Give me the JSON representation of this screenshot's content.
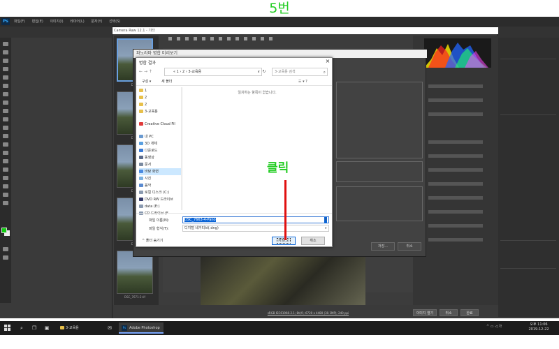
{
  "step_title": "5번",
  "annotation": {
    "label": "클릭"
  },
  "photoshop": {
    "logo": "Ps",
    "menu": [
      "파일(F)",
      "편집(E)",
      "이미지(I)",
      "레이어(L)",
      "문자(Y)",
      "선택(S)"
    ]
  },
  "camera_raw": {
    "title": "Camera Raw 12.1 - 기타",
    "thumbnails": [
      "DSC_",
      "DSC_",
      "DSC_",
      "DSC_",
      "DSC_7671-2.tif"
    ],
    "status_text": "sRGB IEC61966-2.1; 8비트; 6720 x 4480 (30.1MP); 240 ppi",
    "buttons": {
      "open": "이미지 열기",
      "cancel": "취소",
      "done": "완료"
    },
    "histogram_colors": [
      "#ffee00",
      "#ff2222",
      "#2266ff",
      "#22ff66",
      "#ff44ff"
    ]
  },
  "save_options": {
    "title": "파노라마 병합 미리보기",
    "buttons": {
      "save": "저장...",
      "cancel": "취소"
    }
  },
  "dialog": {
    "title": "병합 결과",
    "nav_back": "←",
    "nav_fwd": "→",
    "nav_up": "↑",
    "address": "« 1 › 2 › 3-교육용",
    "address_dropdown": "∨",
    "refresh": "↻",
    "search_placeholder": "3-교육용 검색",
    "search_icon": "⌕",
    "organize": "구성 ▾",
    "new_folder": "새 폴더",
    "view_icons": "☷ ▾   ?",
    "nav_items": [
      {
        "label": "1",
        "icon_color": "#e8c04a"
      },
      {
        "label": "2",
        "icon_color": "#e8c04a"
      },
      {
        "label": "2",
        "icon_color": "#e8c04a"
      },
      {
        "label": "3-교육용",
        "icon_color": "#e8c04a"
      },
      {
        "label": "",
        "icon_color": ""
      },
      {
        "label": "Creative Cloud Fil",
        "icon_color": "#e03a3a"
      },
      {
        "label": "",
        "icon_color": ""
      },
      {
        "label": "내 PC",
        "icon_color": "#6a9ad0"
      },
      {
        "label": "3D 개체",
        "icon_color": "#5aa0e0"
      },
      {
        "label": "다운로드",
        "icon_color": "#3a7ad5"
      },
      {
        "label": "동영상",
        "icon_color": "#5a6a8a"
      },
      {
        "label": "문서",
        "icon_color": "#7a8aa0"
      },
      {
        "label": "바탕 화면",
        "icon_color": "#4a8ae0",
        "selected": true
      },
      {
        "label": "사진",
        "icon_color": "#7ab0e0"
      },
      {
        "label": "음악",
        "icon_color": "#5a8ad0"
      },
      {
        "label": "로컬 디스크 (C:)",
        "icon_color": "#8a9ab0"
      },
      {
        "label": "DVD RW 드라이브",
        "icon_color": "#333a6a"
      },
      {
        "label": "data (E:)",
        "icon_color": "#8a9ab0"
      },
      {
        "label": "CD 드라이브 (F",
        "icon_color": "#8a9ab0"
      }
    ],
    "empty_message": "일치하는 항목이 없습니다.",
    "filename_label": "파일 이름(N):",
    "filename_value": "DSC_7663-4-Pano",
    "filetype_label": "파일 형식(T):",
    "filetype_value": "디지털 네거티브(.dng)",
    "hide_folders": "^ 폴더 숨기기",
    "save_button": "저장(S)",
    "cancel_button": "취소"
  },
  "taskbar": {
    "search_icon": "⌕",
    "task_view_icon": "❐",
    "store_icon": "▣",
    "folder_label": "3-교육용",
    "mail_icon": "✉",
    "photoshop_label": "Adobe Photoshop ...",
    "tray": "^ ▭ ◁ 가",
    "time": "오후 11:06",
    "date": "2019-12-22"
  }
}
